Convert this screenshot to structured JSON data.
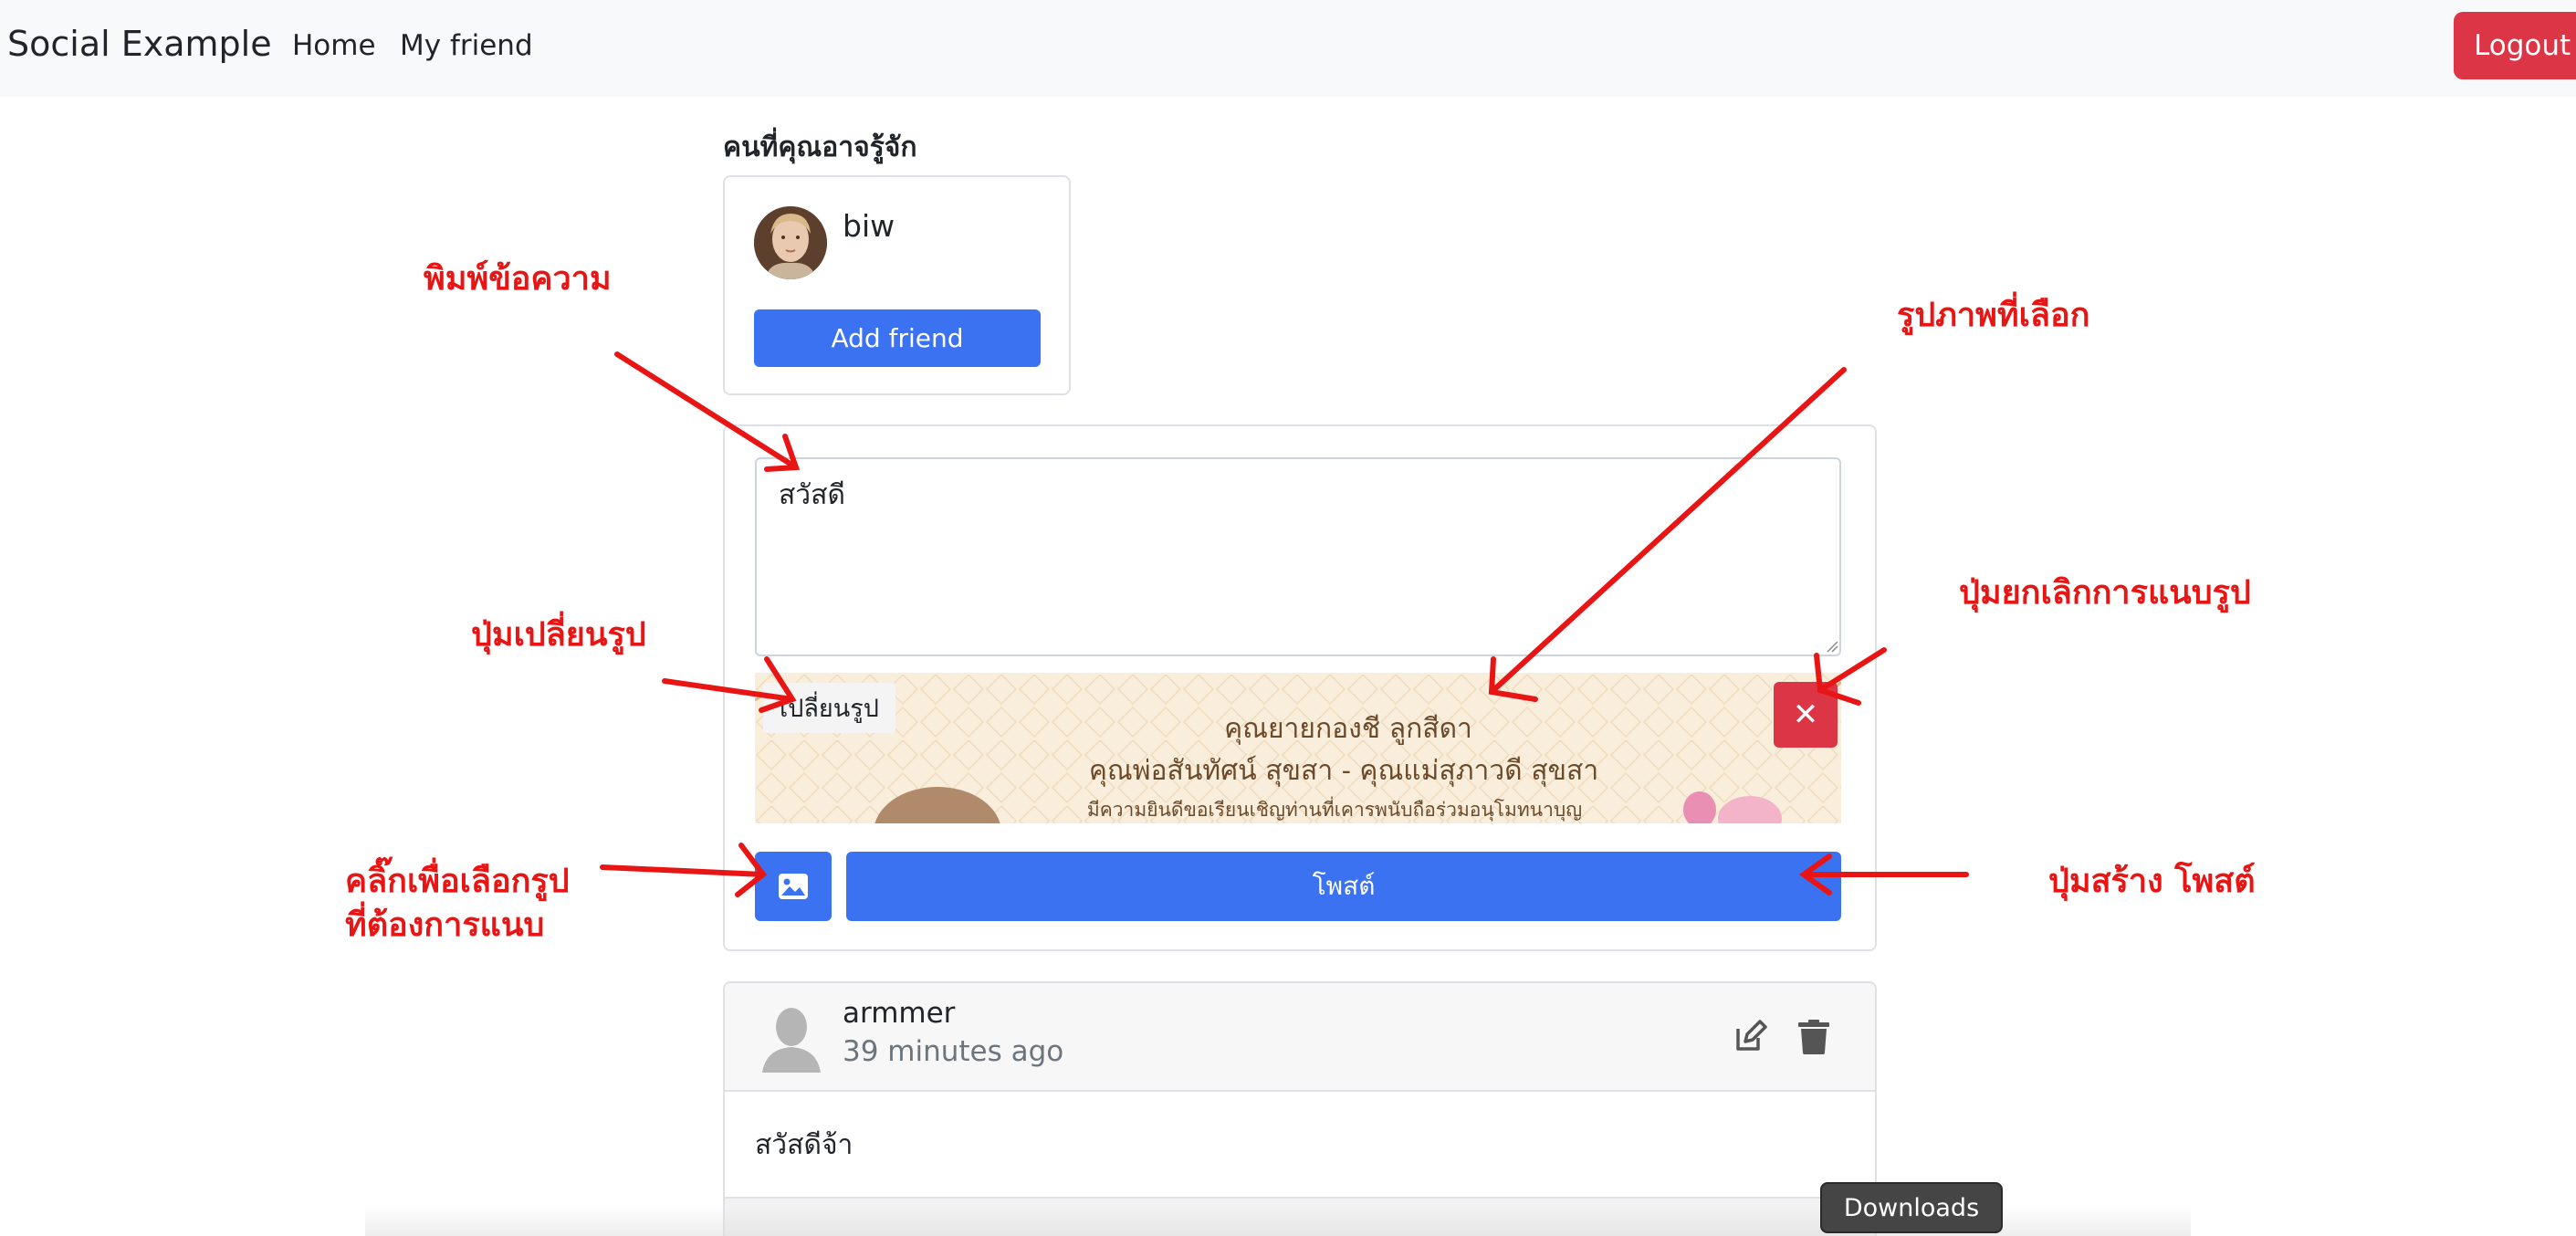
{
  "navbar": {
    "brand": "Social Example",
    "home": "Home",
    "my_friend": "My friend",
    "logout": "Logout"
  },
  "suggestions": {
    "title": "คนที่คุณอาจรู้จัก",
    "users": [
      {
        "name": "biw",
        "action": "Add friend"
      }
    ]
  },
  "composer": {
    "text_value": "สวัสดี",
    "change_image_label": "เปลี่ยนรูป",
    "remove_image_symbol": "✕",
    "post_label": "โพสต์",
    "preview_lines": [
      "คุณยายกองชี  ลูกสีดา",
      "คุณพ่อสันทัศน์  สุขสา - คุณแม่สุภาวดี  สุขสา",
      "มีความยินดีขอเรียนเชิญท่านที่เคารพนับถือร่วมอนุโมทนาบุญ"
    ]
  },
  "feed": {
    "posts": [
      {
        "author": "armmer",
        "time": "39 minutes ago",
        "body": "สวัสดีจ้า"
      }
    ]
  },
  "annotations": {
    "type_message": "พิมพ์ข้อความ",
    "selected_image": "รูปภาพที่เลือก",
    "cancel_attach": "ปุ่มยกเลิกการแนบรูป",
    "change_image": "ปุ่มเปลี่ยนรูป",
    "click_select_line1": "คลิ๊กเพื่อเลือกรูป",
    "click_select_line2": "ที่ต้องการแนบ",
    "create_post": "ปุ่มสร้าง โพสต์"
  },
  "downloads": "Downloads",
  "colors": {
    "primary": "#3b72f2",
    "danger": "#dc3545",
    "annotation": "#e81515",
    "navbar_bg": "#f8f9fa"
  }
}
